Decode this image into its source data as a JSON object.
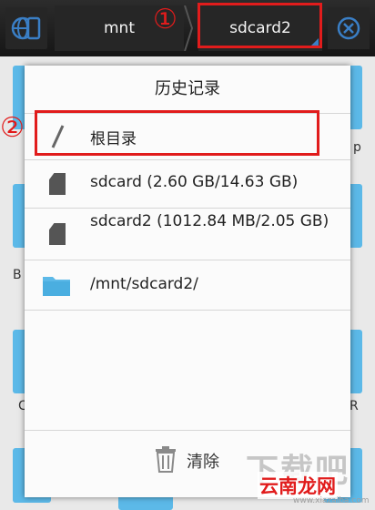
{
  "toolbar": {
    "crumbs": [
      "mnt",
      "sdcard2"
    ],
    "annotation_1": "①"
  },
  "dialog": {
    "title": "历史记录",
    "annotation_2": "②",
    "items": [
      {
        "icon": "root-slash-icon",
        "label": "根目录"
      },
      {
        "icon": "sdcard-icon",
        "label": "sdcard (2.60 GB/14.63 GB)"
      },
      {
        "icon": "sdcard-icon",
        "label": "sdcard2 (1012.84 MB/2.05 GB)"
      },
      {
        "icon": "folder-icon",
        "label": "/mnt/sdcard2/"
      }
    ],
    "clear_label": "清除"
  },
  "background_letters": [
    "p",
    "B",
    "C",
    "R"
  ],
  "watermark": {
    "logo": "下载吧",
    "name": "云南龙网",
    "url": "www.xiazaiba.com"
  },
  "colors": {
    "accent_blue": "#3a7fc6",
    "annotation_red": "#e11c1c",
    "folder_blue": "#5cb9e8"
  }
}
